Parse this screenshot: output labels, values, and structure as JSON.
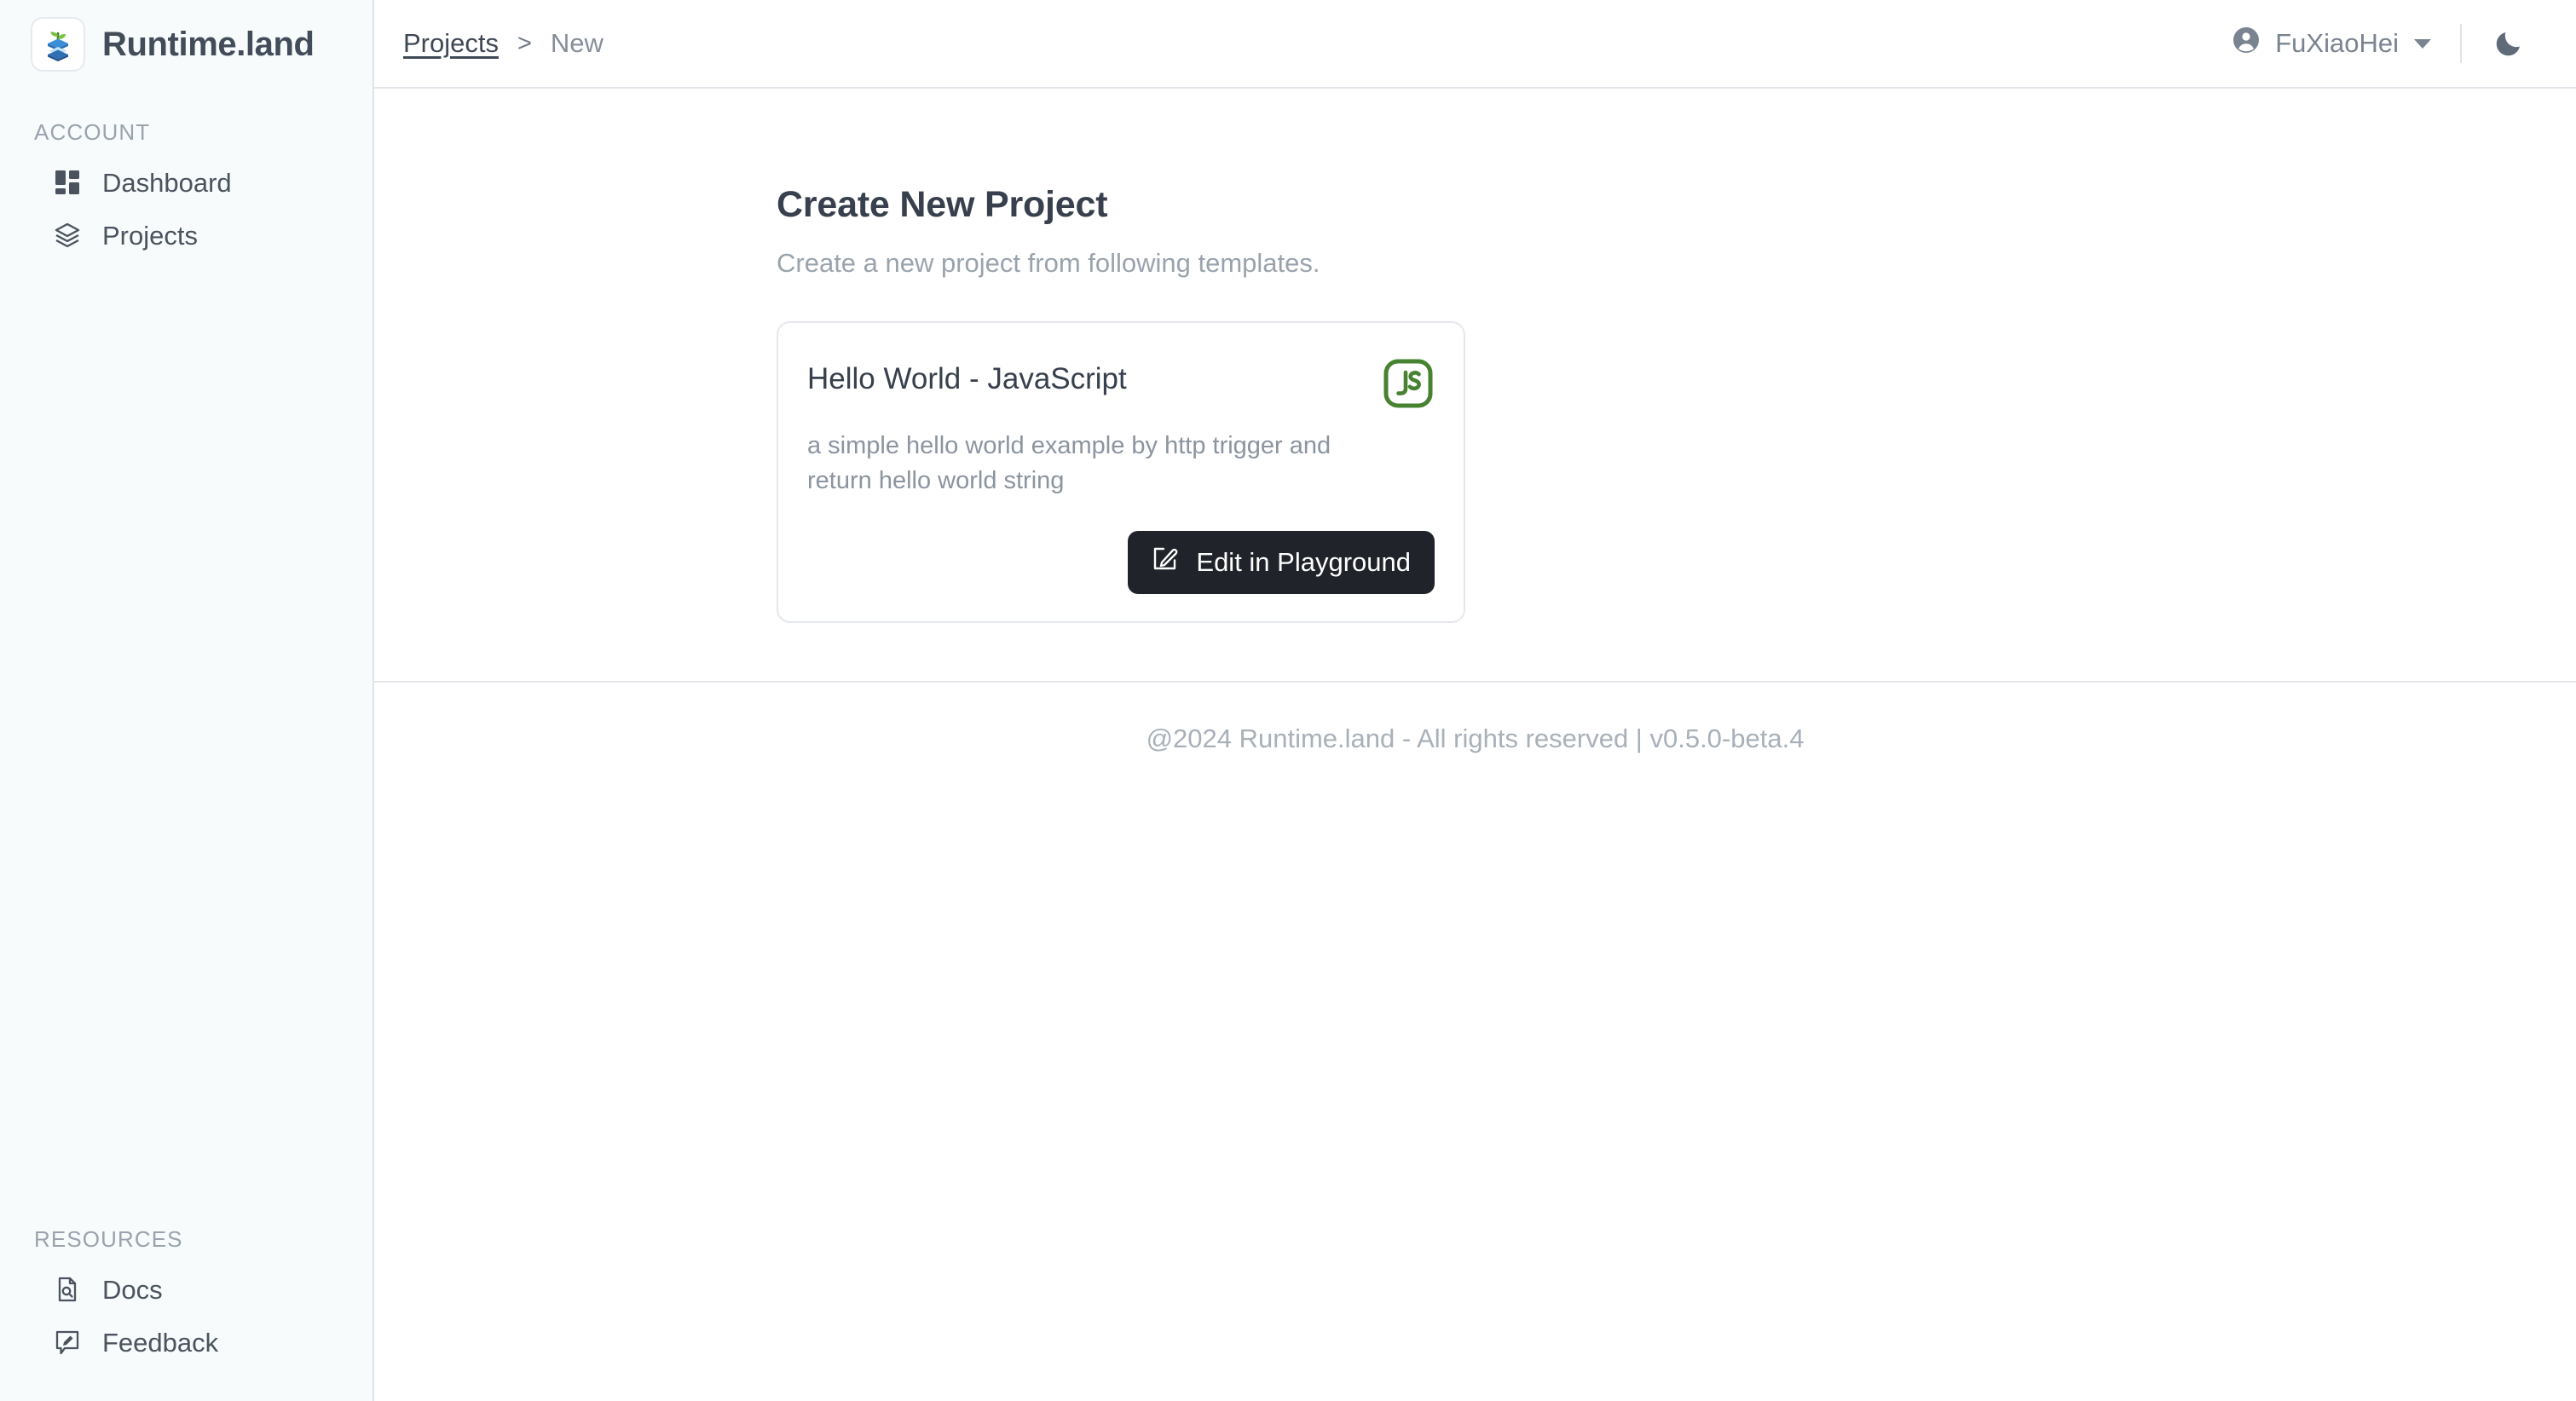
{
  "brand": {
    "name": "Runtime.land",
    "logo_icon": "layered-sprout-logo"
  },
  "sidebar": {
    "sections": [
      {
        "heading": "ACCOUNT",
        "items": [
          {
            "label": "Dashboard",
            "icon": "grid-dashboard-icon"
          },
          {
            "label": "Projects",
            "icon": "layers-icon"
          }
        ]
      },
      {
        "heading": "RESOURCES",
        "items": [
          {
            "label": "Docs",
            "icon": "document-search-icon"
          },
          {
            "label": "Feedback",
            "icon": "comment-edit-icon"
          }
        ]
      }
    ]
  },
  "topbar": {
    "breadcrumb": {
      "link_label": "Projects",
      "separator": ">",
      "current_label": "New"
    },
    "user": {
      "name": "FuXiaoHei",
      "avatar_icon": "account-circle-icon",
      "caret_icon": "chevron-down-icon"
    },
    "theme_toggle": {
      "icon": "moon-icon"
    }
  },
  "main": {
    "title": "Create New Project",
    "subtitle": "Create a new project from following templates.",
    "templates": [
      {
        "title": "Hello World - JavaScript",
        "description": "a simple hello world example by http trigger and return hello world string",
        "lang_icon": "javascript-icon",
        "lang_label": "JS",
        "action_label": "Edit in Playground",
        "action_icon": "pencil-square-icon"
      }
    ]
  },
  "footer": {
    "text": "@2024 Runtime.land - All rights reserved | v0.5.0-beta.4"
  },
  "colors": {
    "sidebar_bg": "#f7fbfc",
    "text_primary": "#37404c",
    "text_muted": "#9aa3ad",
    "border": "#e2e6ea",
    "button_bg": "#20242a",
    "js_green": "#478230",
    "logo_blue": "#2f6fb5"
  }
}
